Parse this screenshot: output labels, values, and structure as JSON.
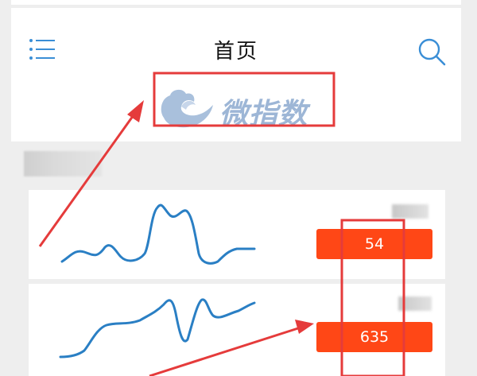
{
  "header": {
    "title": "首页",
    "menu_icon": "menu-list-icon",
    "search_icon": "search-icon"
  },
  "logo": {
    "text": "微指数",
    "icon": "cloud-icon",
    "color": "#9db6d6"
  },
  "index_cards": [
    {
      "value": "54"
    },
    {
      "value": "635"
    }
  ],
  "colors": {
    "accent": "#ff4716",
    "sparkline": "#2a7fc4",
    "annotation": "#e53b3b",
    "icon": "#3a8ed6"
  }
}
